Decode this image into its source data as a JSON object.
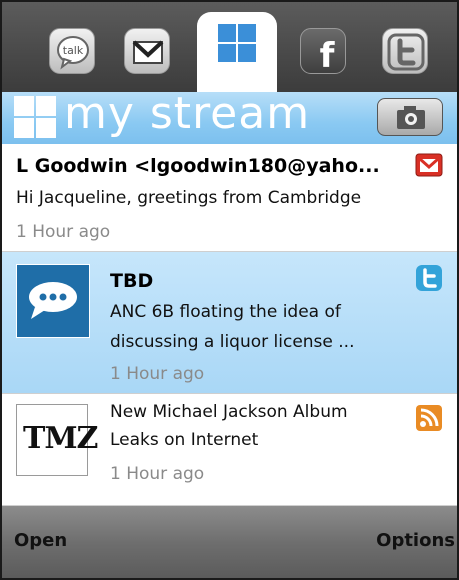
{
  "app_bar": {
    "icons": [
      {
        "name": "talk-icon",
        "label": "talk"
      },
      {
        "name": "gmail-icon"
      },
      {
        "name": "mystream-icon",
        "active": true
      },
      {
        "name": "facebook-icon",
        "letter": "f"
      },
      {
        "name": "twitter-icon",
        "letter": "t"
      }
    ]
  },
  "header": {
    "title": "my stream",
    "camera_icon": "camera-icon"
  },
  "stream": [
    {
      "sender": "L Goodwin <lgoodwin180@yaho...",
      "lines": [
        "Hi Jacqueline, greetings from Cambridge"
      ],
      "time": "1 Hour ago",
      "source": "gmail-icon",
      "selected": false
    },
    {
      "sender": "TBD",
      "lines": [
        "ANC 6B floating the idea of",
        "discussing  a liquor license ..."
      ],
      "time": "1 Hour ago",
      "source": "twitter-icon",
      "avatar": "chat-bubble-icon",
      "selected": true
    },
    {
      "sender": "",
      "lines": [
        "New Michael Jackson Album",
        "Leaks on Internet"
      ],
      "time": "1 Hour ago",
      "source": "rss-icon",
      "avatar_text": "TMZ",
      "selected": false
    }
  ],
  "softkeys": {
    "left": "Open",
    "right": "Options"
  },
  "colors": {
    "header_blue": "#8ac9f2",
    "selected_row": "#b6def8",
    "gmail_red": "#d93025",
    "twitter_blue": "#33a3d9",
    "rss_orange": "#e98b24"
  }
}
